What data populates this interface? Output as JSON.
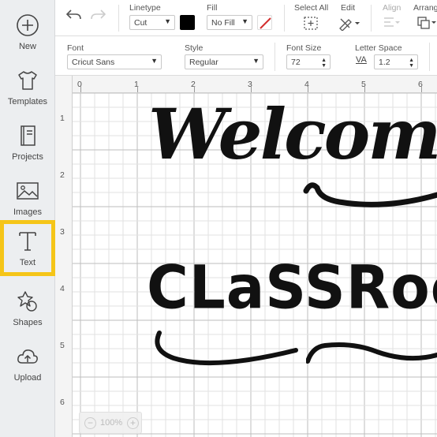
{
  "sidebar": {
    "items": [
      {
        "label": "New",
        "icon": "plus-circle-icon"
      },
      {
        "label": "Templates",
        "icon": "tshirt-icon"
      },
      {
        "label": "Projects",
        "icon": "book-icon"
      },
      {
        "label": "Images",
        "icon": "image-icon"
      },
      {
        "label": "Text",
        "icon": "text-t-icon",
        "highlighted": true
      },
      {
        "label": "Shapes",
        "icon": "shapes-icon"
      },
      {
        "label": "Upload",
        "icon": "cloud-upload-icon"
      }
    ],
    "highlight_color": "#f5c518"
  },
  "toolbar": {
    "linetype_label": "Linetype",
    "linetype_value": "Cut",
    "fill_label": "Fill",
    "fill_value": "No Fill",
    "select_all_label": "Select All",
    "edit_label": "Edit",
    "align_label": "Align",
    "arrange_label": "Arrang",
    "swatch_color": "#000000",
    "fill_line_color": "#d32f2f"
  },
  "text_toolbar": {
    "font_label": "Font",
    "font_value": "Cricut Sans",
    "style_label": "Style",
    "style_value": "Regular",
    "font_size_label": "Font Size",
    "font_size_value": "72",
    "letter_space_label": "Letter Space",
    "letter_space_icon_text": "VA",
    "letter_space_value": "1.2"
  },
  "canvas": {
    "ruler_top": [
      "0",
      "1",
      "2",
      "3",
      "4",
      "5",
      "6"
    ],
    "ruler_left": [
      "1",
      "2",
      "3",
      "4",
      "5",
      "6"
    ],
    "text_welcome": "Welcome",
    "text_classroom": "CLaSSRoom",
    "zoom_value": "100%"
  }
}
